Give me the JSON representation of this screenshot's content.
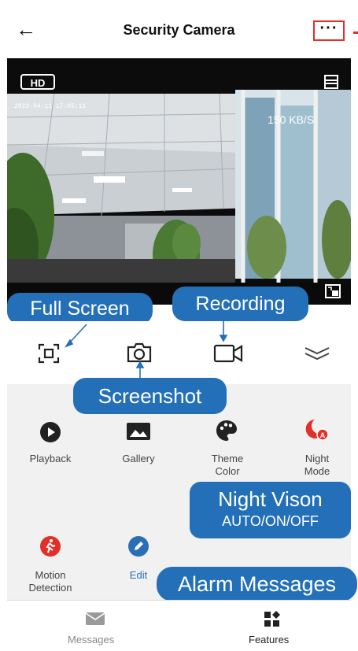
{
  "header": {
    "title": "Security Camera",
    "back_icon": "arrow-left-icon",
    "more_label": "···"
  },
  "video": {
    "quality": "HD",
    "timestamp": "2022-04-11 17:05:11",
    "bitrate": "150 KB/S"
  },
  "controls": [
    {
      "id": "fullscreen",
      "icon": "fullscreen-icon"
    },
    {
      "id": "screenshot",
      "icon": "camera-icon"
    },
    {
      "id": "record",
      "icon": "video-icon"
    },
    {
      "id": "collapse",
      "icon": "chevron-double-down-icon"
    }
  ],
  "callouts": {
    "fullscreen": "Full Screen",
    "recording": "Recording",
    "screenshot": "Screenshot",
    "night_title": "Night Vison",
    "night_sub": "AUTO/ON/OFF",
    "alarm": "Alarm Messages"
  },
  "features": {
    "playback": "Playback",
    "gallery": "Gallery",
    "theme_1": "Theme",
    "theme_2": "Color",
    "night_1": "Night",
    "night_2": "Mode",
    "motion_1": "Motion",
    "motion_2": "Detection",
    "edit": "Edit"
  },
  "bottom_tabs": {
    "messages": "Messages",
    "features": "Features"
  },
  "colors": {
    "callout": "#2470b8",
    "accent_red": "#e0302a",
    "edit_blue": "#2a6fb5"
  }
}
